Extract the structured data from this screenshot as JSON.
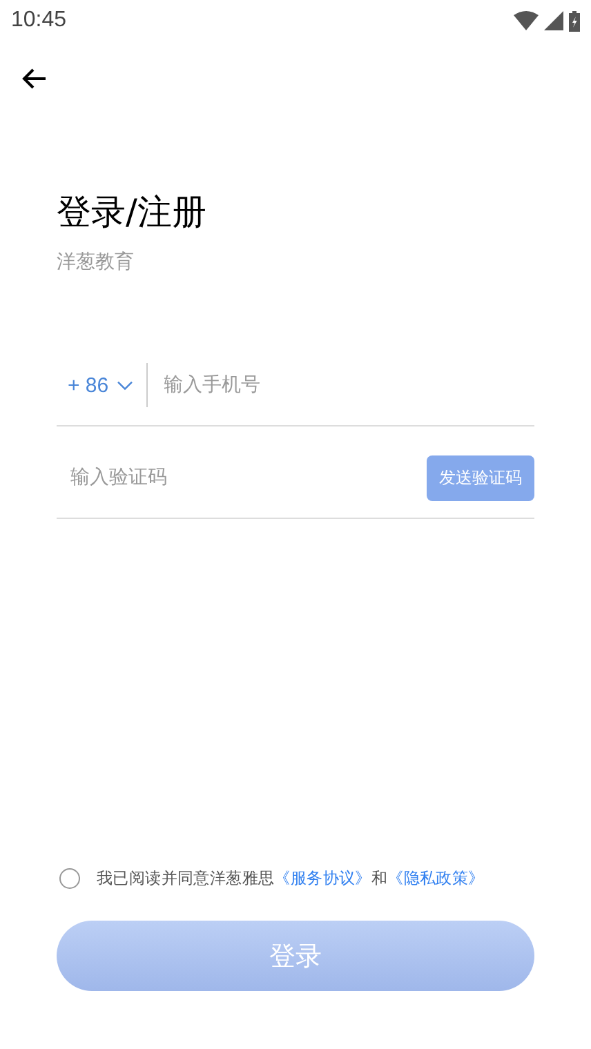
{
  "status_bar": {
    "time": "10:45"
  },
  "title": "登录/注册",
  "subtitle": "洋葱教育",
  "phone": {
    "country_code": "+ 86",
    "placeholder": "输入手机号"
  },
  "code": {
    "placeholder": "输入验证码",
    "send_button": "发送验证码"
  },
  "agreement": {
    "checked": false,
    "parts": [
      {
        "kind": "text",
        "text": "我已阅读并同意洋葱雅思"
      },
      {
        "kind": "link",
        "text": "《服务协议》"
      },
      {
        "kind": "text",
        "text": "和"
      },
      {
        "kind": "link",
        "text": "《隐私政策》"
      }
    ]
  },
  "login_button": {
    "label": "登录",
    "disabled": true
  }
}
